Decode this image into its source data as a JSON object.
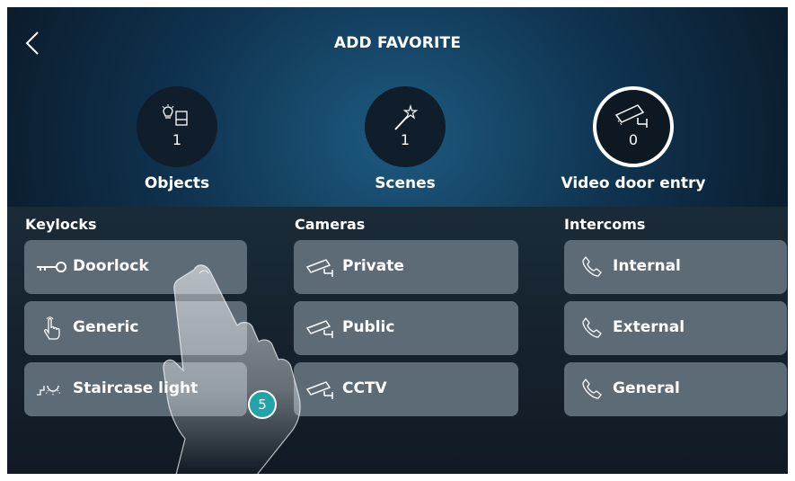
{
  "header": {
    "title": "ADD FAVORITE",
    "back_icon": "chevron-left-icon"
  },
  "categories": [
    {
      "icon": "light-switch-icon",
      "count": "1",
      "label": "Objects",
      "selected": false
    },
    {
      "icon": "magic-wand-icon",
      "count": "1",
      "label": "Scenes",
      "selected": false
    },
    {
      "icon": "security-camera-icon",
      "count": "0",
      "label": "Video door entry",
      "selected": true
    }
  ],
  "columns": {
    "keylocks": {
      "title": "Keylocks",
      "items": [
        {
          "label": "Doorlock",
          "icon": "key-icon"
        },
        {
          "label": "Generic",
          "icon": "hand-pointer-icon"
        },
        {
          "label": "Staircase light",
          "icon": "staircase-light-icon"
        }
      ]
    },
    "cameras": {
      "title": "Cameras",
      "items": [
        {
          "label": "Private",
          "icon": "camera-icon"
        },
        {
          "label": "Public",
          "icon": "camera-icon"
        },
        {
          "label": "CCTV",
          "icon": "camera-icon"
        }
      ]
    },
    "intercoms": {
      "title": "Intercoms",
      "items": [
        {
          "label": "Internal",
          "icon": "phone-icon"
        },
        {
          "label": "External",
          "icon": "phone-icon"
        },
        {
          "label": "General",
          "icon": "phone-icon"
        }
      ]
    }
  },
  "step_badge": "5",
  "colors": {
    "accent": "#23a2a7",
    "tile": "#5d6b77",
    "background": "#0f3350"
  }
}
